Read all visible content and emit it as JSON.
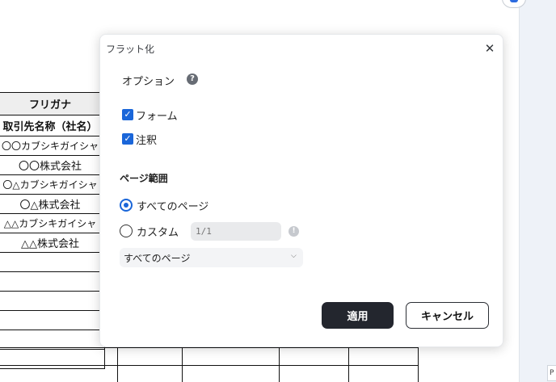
{
  "background_table": {
    "header": "フリガナ",
    "subheader": "取引先名称（社名）",
    "rows": [
      "〇〇カブシキガイシャ",
      "〇〇株式会社",
      "〇△カブシキガイシャ",
      "〇△株式会社",
      "△△カブシキガイシャ",
      "△△株式会社"
    ]
  },
  "side_panel": {
    "box_text": "P"
  },
  "dialog": {
    "title": "フラット化",
    "close_glyph": "✕",
    "options_label": "オプション",
    "help_glyph": "?",
    "checkboxes": [
      {
        "label": "フォーム",
        "checked": true
      },
      {
        "label": "注釈",
        "checked": true
      }
    ],
    "page_range_label": "ページ範囲",
    "radio_all_label": "すべてのページ",
    "radio_custom_label": "カスタム",
    "selected_radio": "すべてのページ",
    "custom_placeholder": "1/1",
    "warning_glyph": "!",
    "select_value": "すべてのページ",
    "select_chevron": "⌵",
    "apply_label": "適用",
    "cancel_label": "キャンセル",
    "accent_color": "#1a66d9",
    "primary_button_color": "#23262e"
  }
}
